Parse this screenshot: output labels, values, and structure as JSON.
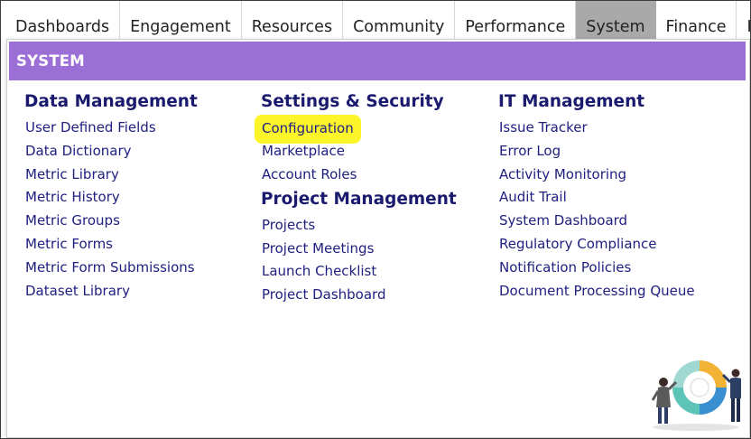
{
  "nav": {
    "items": [
      {
        "label": "Dashboards"
      },
      {
        "label": "Engagement"
      },
      {
        "label": "Resources"
      },
      {
        "label": "Community"
      },
      {
        "label": "Performance"
      },
      {
        "label": "System",
        "active": true
      },
      {
        "label": "Finance"
      },
      {
        "label": "Help"
      }
    ]
  },
  "panel": {
    "title": "SYSTEM"
  },
  "columns": {
    "data_management": {
      "title": "Data Management",
      "links": [
        "User Defined Fields",
        "Data Dictionary",
        "Metric Library",
        "Metric History",
        "Metric Groups",
        "Metric Forms",
        "Metric Form Submissions",
        "Dataset Library"
      ]
    },
    "settings_security": {
      "title": "Settings & Security",
      "links": [
        "Configuration",
        "Marketplace",
        "Account Roles"
      ],
      "highlighted": "Configuration"
    },
    "project_management": {
      "title": "Project Management",
      "links": [
        "Projects",
        "Project Meetings",
        "Launch Checklist",
        "Project Dashboard"
      ]
    },
    "it_management": {
      "title": "IT Management",
      "links": [
        "Issue Tracker",
        "Error Log",
        "Activity Monitoring",
        "Audit Trail",
        "System Dashboard",
        "Regulatory Compliance",
        "Notification Policies",
        "Document Processing Queue"
      ]
    }
  },
  "colors": {
    "header_bg": "#9b6fd6",
    "section_title": "#1a1a6e",
    "link": "#202080",
    "highlight": "#fbf52a",
    "active_tab": "#a9a9a9"
  },
  "icons": {
    "illustration": "people-puzzle-ring-illustration"
  }
}
